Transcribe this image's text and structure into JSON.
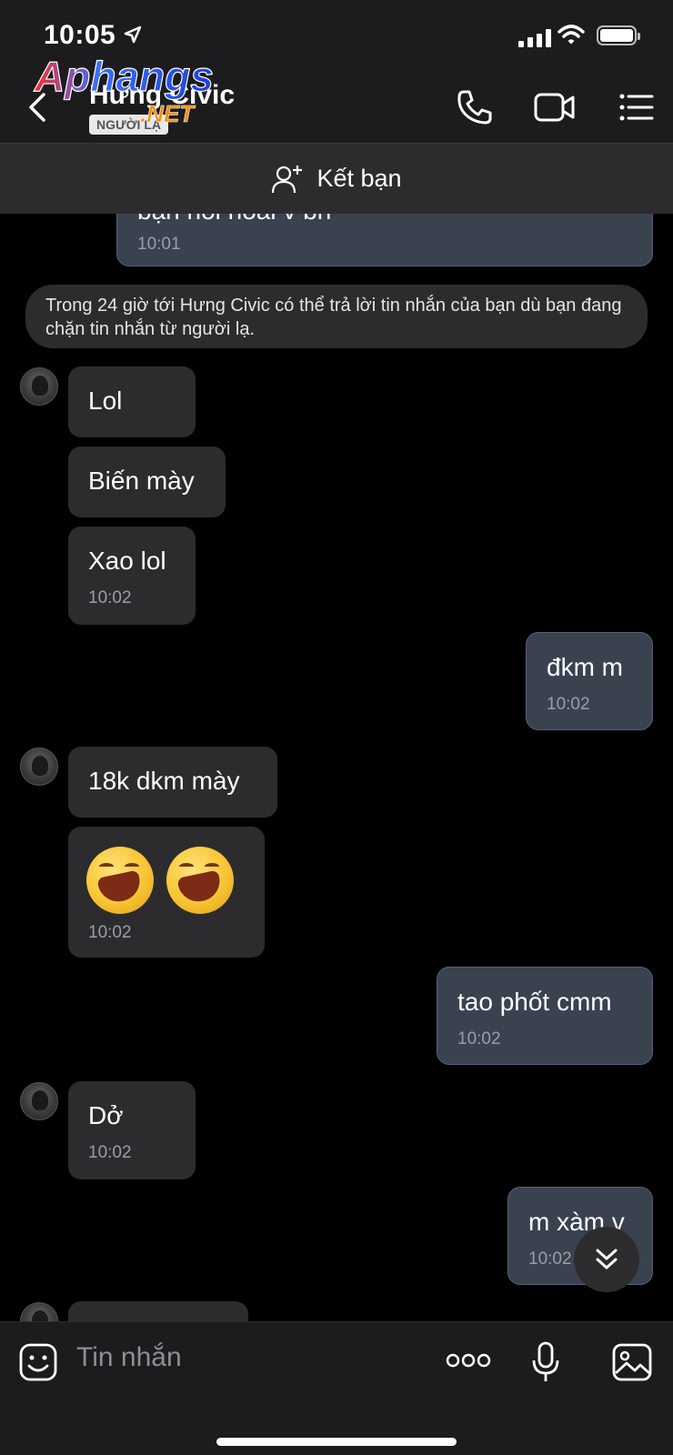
{
  "status_bar": {
    "time": "10:05"
  },
  "header": {
    "contact_name": "Hưng Civic",
    "stranger_badge": "NGƯỜI LẠ"
  },
  "watermark": {
    "brand": "Aphangs",
    "suffix": ".NET"
  },
  "add_friend": {
    "label": "Kết bạn"
  },
  "notice": {
    "text": "Trong 24 giờ tới Hưng Civic có thể trả lời tin nhắn của bạn dù bạn đang chặn tin nhắn từ người lạ."
  },
  "messages": [
    {
      "direction": "out",
      "text": "bạn nói hoài v bn",
      "time": "10:01"
    },
    {
      "direction": "in",
      "text": "Lol",
      "time": ""
    },
    {
      "direction": "in",
      "text": "Biến mày",
      "time": ""
    },
    {
      "direction": "in",
      "text": "Xao lol",
      "time": "10:02"
    },
    {
      "direction": "out",
      "text": "đkm m",
      "time": "10:02"
    },
    {
      "direction": "in",
      "text": "18k dkm mày",
      "time": ""
    },
    {
      "direction": "in",
      "text": "",
      "emoji": "laughing-face x2",
      "time": "10:02"
    },
    {
      "direction": "out",
      "text": "tao phốt cmm",
      "time": "10:02"
    },
    {
      "direction": "in",
      "text": "Dở",
      "time": "10:02"
    },
    {
      "direction": "out",
      "text": "m xàm v",
      "time": "10:02"
    }
  ],
  "input": {
    "placeholder": "Tin nhắn"
  },
  "colors": {
    "background": "#000000",
    "incoming": "#2c2c2e",
    "outgoing": "#3a4250",
    "bar": "#1c1c1e"
  }
}
